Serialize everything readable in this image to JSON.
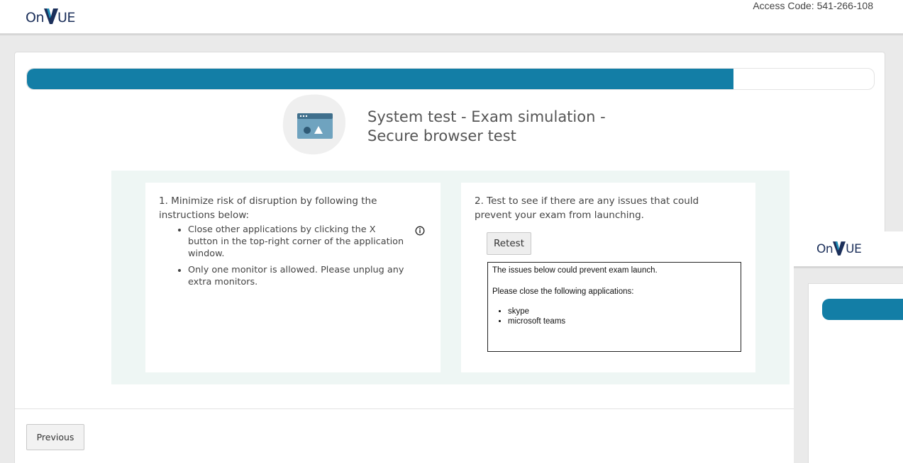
{
  "header": {
    "logo_prefix": "On",
    "logo_suffix": "UE",
    "access_code": "Access Code: 541-266-108"
  },
  "progress": {
    "fraction": 0.834
  },
  "title": {
    "line1": "System test - Exam simulation -",
    "line2": "Secure browser test"
  },
  "left_box": {
    "heading": "1. Minimize risk of disruption by following the instructions below:",
    "items": [
      "Close other applications by clicking the X button in the top-right corner of the application window.",
      "Only one monitor is allowed. Please unplug any extra monitors."
    ]
  },
  "right_box": {
    "heading": "2. Test to see if there are any issues that could prevent your exam from launching.",
    "retest_label": "Retest",
    "issues_intro": "The issues below could prevent exam launch.",
    "issues_instruction": "Please close the following applications:",
    "apps": [
      "skype",
      "microsoft teams"
    ]
  },
  "footer": {
    "previous_label": "Previous"
  },
  "colors": {
    "accent": "#137ea6",
    "brand_navy": "#1b2f5a",
    "panel_bg": "#eef6f4"
  }
}
